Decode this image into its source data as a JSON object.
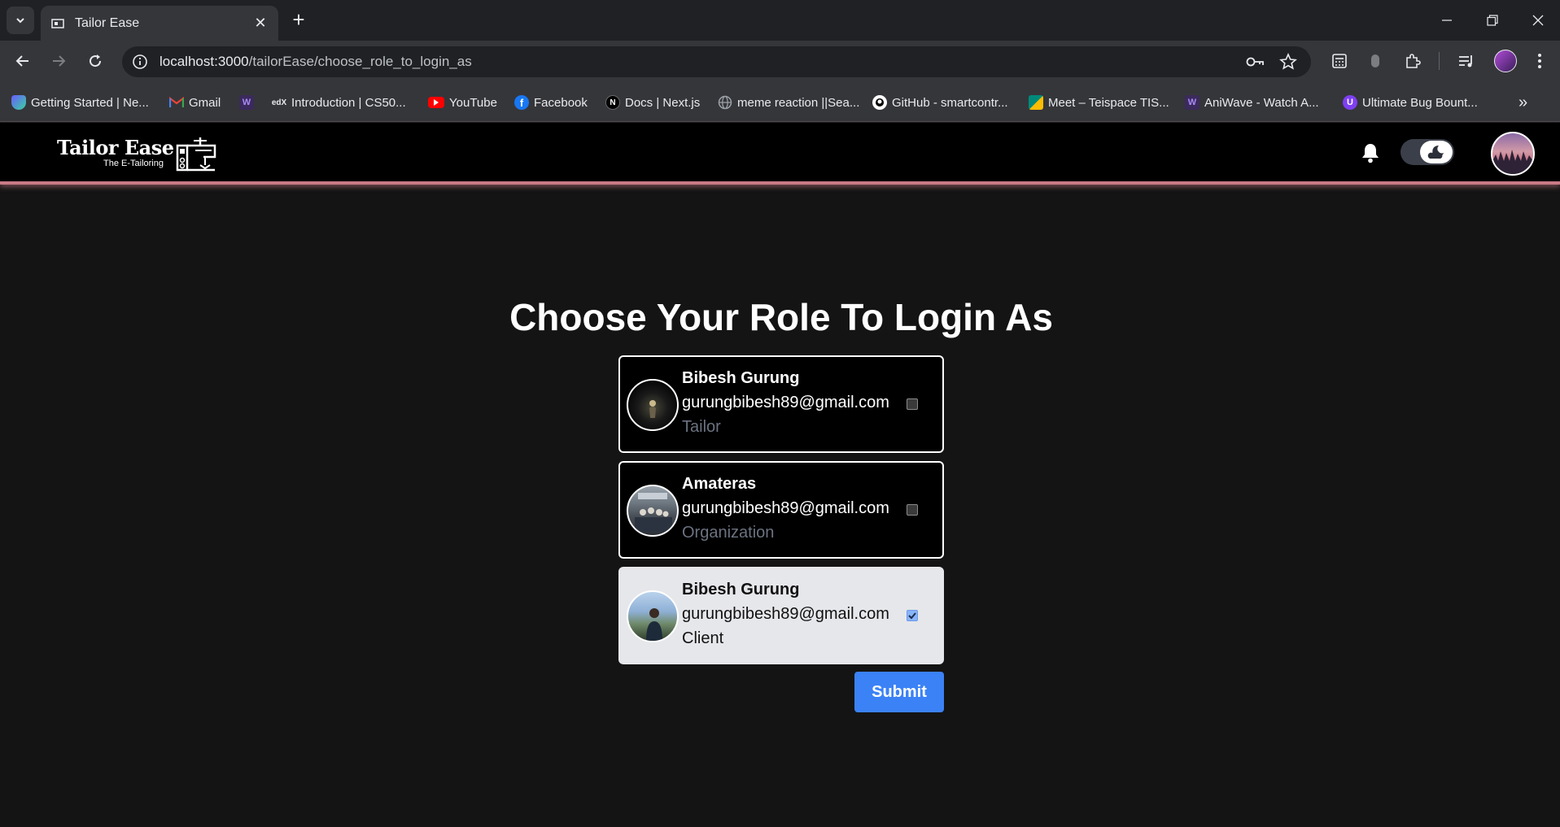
{
  "browser": {
    "tab": {
      "title": "Tailor Ease"
    },
    "omnibox": {
      "host": "localhost:3000",
      "path": "/tailorEase/choose_role_to_login_as"
    },
    "bookmarks": [
      {
        "label": "Getting Started | Ne...",
        "icon": "shield-gradient-icon",
        "color": "#6a5cff"
      },
      {
        "label": "Gmail",
        "icon": "gmail-icon",
        "color": "#ea4335"
      },
      {
        "label": "",
        "icon": "w-purple-icon",
        "color": "#3b2a5c"
      },
      {
        "label": "Introduction | CS50...",
        "icon": "edx-icon",
        "color": "#35363a"
      },
      {
        "label": "YouTube",
        "icon": "youtube-icon",
        "color": "#ff0000"
      },
      {
        "label": "Facebook",
        "icon": "facebook-icon",
        "color": "#1877f2"
      },
      {
        "label": "Docs | Next.js",
        "icon": "nextjs-icon",
        "color": "#000000"
      },
      {
        "label": "meme reaction ||Sea...",
        "icon": "globe-icon",
        "color": "#9aa0a6"
      },
      {
        "label": "GitHub - smartcontr...",
        "icon": "github-icon",
        "color": "#ffffff"
      },
      {
        "label": "Meet – Teispace TIS...",
        "icon": "meet-icon",
        "color": "#00897b"
      },
      {
        "label": "AniWave - Watch A...",
        "icon": "w-purple-icon",
        "color": "#3b2a5c"
      },
      {
        "label": "Ultimate Bug Bount...",
        "icon": "bug-bounty-icon",
        "color": "#7e3ff2"
      }
    ]
  },
  "header": {
    "logo_title": "Tailor Ease",
    "logo_subtitle": "The E-Tailoring"
  },
  "main": {
    "title": "Choose Your Role To Login As",
    "roles": [
      {
        "name": "Bibesh Gurung",
        "email": "gurungbibesh89@gmail.com",
        "role": "Tailor",
        "selected": false
      },
      {
        "name": "Amateras",
        "email": "gurungbibesh89@gmail.com",
        "role": "Organization",
        "selected": false
      },
      {
        "name": "Bibesh Gurung",
        "email": "gurungbibesh89@gmail.com",
        "role": "Client",
        "selected": true
      }
    ],
    "submit_label": "Submit"
  },
  "colors": {
    "accent": "#3b82f6",
    "header_underline": "#c97a86",
    "selected_card": "#e6e7eb"
  }
}
